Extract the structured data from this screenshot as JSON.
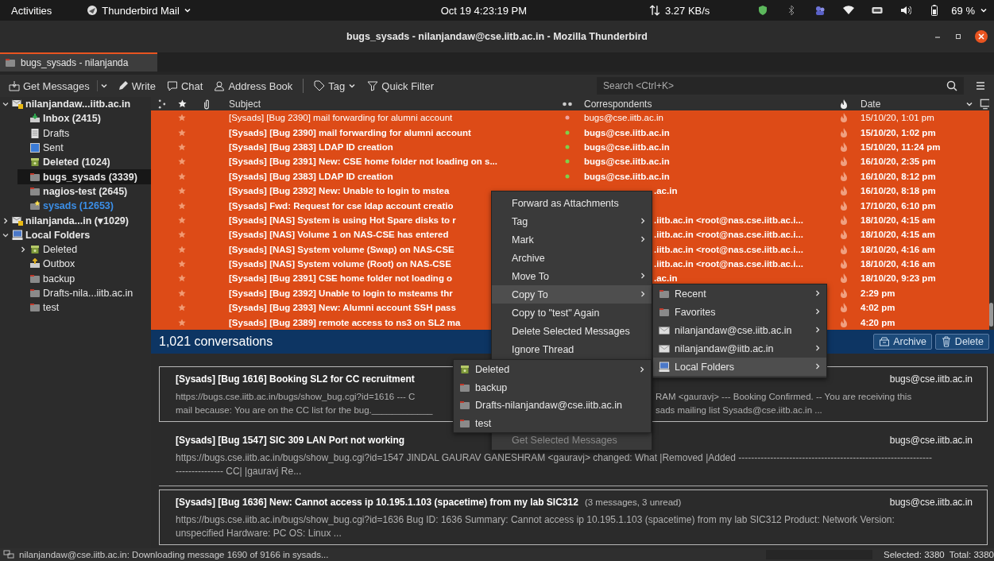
{
  "top_bar": {
    "activities": "Activities",
    "app_menu": "Thunderbird Mail",
    "clock": "Oct 19  4:23:19 PM",
    "net_speed": "3.27 KB/s",
    "battery": "69 %"
  },
  "window": {
    "title": "bugs_sysads - nilanjandaw@cse.iitb.ac.in - Mozilla Thunderbird"
  },
  "tabs": [
    {
      "label": "bugs_sysads - nilanjanda",
      "selected": true
    }
  ],
  "toolbar": [
    {
      "kind": "get",
      "label": "Get Messages"
    },
    {
      "kind": "split"
    },
    {
      "kind": "write",
      "label": "Write"
    },
    {
      "kind": "chat",
      "label": "Chat"
    },
    {
      "kind": "address",
      "label": "Address Book"
    },
    {
      "kind": "separator"
    },
    {
      "kind": "tag",
      "label": "Tag"
    },
    {
      "kind": "filter",
      "label": "Quick Filter"
    }
  ],
  "search": {
    "placeholder": "Search <Ctrl+K>"
  },
  "folders": [
    {
      "kind": "account",
      "label": "nilanjandaw...iitb.ac.in",
      "expanded": true,
      "selected": false,
      "unread": true,
      "children": [
        {
          "kind": "inbox",
          "label": "Inbox (2415)",
          "selected": false,
          "unread": true
        },
        {
          "kind": "drafts",
          "label": "Drafts",
          "selected": false,
          "unread": false
        },
        {
          "kind": "sent",
          "label": "Sent",
          "selected": false,
          "unread": false
        },
        {
          "kind": "trash",
          "label": "Deleted (1024)",
          "selected": false,
          "unread": true
        },
        {
          "kind": "folder",
          "label": "bugs_sysads (3339)",
          "selected": true,
          "unread": true
        },
        {
          "kind": "folder",
          "label": "nagios-test (2645)",
          "selected": false,
          "unread": true
        },
        {
          "kind": "newmail",
          "label": "sysads (12653)",
          "selected": false,
          "unread": true
        }
      ]
    },
    {
      "kind": "account",
      "label": "nilanjanda...in (▾1029)",
      "expanded": false,
      "selected": false,
      "unread": true
    },
    {
      "kind": "local",
      "label": "Local Folders",
      "expanded": true,
      "selected": false,
      "unread": true,
      "children": [
        {
          "kind": "trash",
          "label": "Deleted",
          "expanded": false,
          "selected": false,
          "unread": false
        },
        {
          "kind": "outbox",
          "label": "Outbox",
          "selected": false,
          "unread": false
        },
        {
          "kind": "folder",
          "label": "backup",
          "selected": false,
          "unread": false
        },
        {
          "kind": "folder",
          "label": "Drafts-nila...iitb.ac.in",
          "selected": false,
          "unread": false
        },
        {
          "kind": "folder",
          "label": "test",
          "selected": false,
          "unread": false
        }
      ]
    }
  ],
  "message_list": {
    "columns": {
      "subject": "Subject",
      "correspondents": "Correspondents",
      "date": "Date"
    },
    "rows": [
      {
        "subject": "[Sysads] [Bug 2390] mail forwarding for alumni account",
        "correspondent": "bugs@cse.iitb.ac.in",
        "date": "15/10/20, 1:01 pm",
        "unread": false,
        "selected": true
      },
      {
        "subject": "[Sysads] [Bug 2390] mail forwarding for alumni account",
        "correspondent": "bugs@cse.iitb.ac.in",
        "date": "15/10/20, 1:02 pm",
        "unread": true,
        "selected": true
      },
      {
        "subject": "[Sysads] [Bug 2383] LDAP ID creation",
        "correspondent": "bugs@cse.iitb.ac.in",
        "date": "15/10/20, 11:24 pm",
        "unread": true,
        "selected": true
      },
      {
        "subject": "[Sysads] [Bug 2391] New: CSE home folder not loading on s...",
        "correspondent": "bugs@cse.iitb.ac.in",
        "date": "16/10/20, 2:35 pm",
        "unread": true,
        "selected": true
      },
      {
        "subject": "[Sysads] [Bug 2383] LDAP ID creation",
        "correspondent": "bugs@cse.iitb.ac.in",
        "date": "16/10/20, 8:12 pm",
        "unread": true,
        "selected": true
      },
      {
        "subject": "[Sysads] [Bug 2392] New: Unable to login to mstea",
        "correspondent": ".ac.in",
        "date": "16/10/20, 8:18 pm",
        "unread": true,
        "selected": true
      },
      {
        "subject": "[Sysads] Fwd: Request for cse ldap account creatio",
        "date": "17/10/20, 6:10 pm",
        "unread": true,
        "selected": true
      },
      {
        "subject": "[Sysads] [NAS] System is using Hot Spare disks to r",
        "correspondent": ".iitb.ac.in <root@nas.cse.iitb.ac.i...",
        "date": "18/10/20, 4:15 am",
        "unread": true,
        "selected": true
      },
      {
        "subject": "[Sysads] [NAS] Volume 1 on NAS-CSE has entered",
        "correspondent": ".iitb.ac.in <root@nas.cse.iitb.ac.i...",
        "date": "18/10/20, 4:15 am",
        "unread": true,
        "selected": true
      },
      {
        "subject": "[Sysads] [NAS] System volume (Swap) on NAS-CSE",
        "correspondent": ".iitb.ac.in <root@nas.cse.iitb.ac.i...",
        "date": "18/10/20, 4:16 am",
        "unread": true,
        "selected": true
      },
      {
        "subject": "[Sysads] [NAS] System volume (Root) on NAS-CSE",
        "correspondent": ".iitb.ac.in <root@nas.cse.iitb.ac.i...",
        "date": "18/10/20, 4:16 am",
        "unread": true,
        "selected": true
      },
      {
        "subject": "[Sysads] [Bug 2391] CSE home folder not loading o",
        "correspondent": ".ac.in",
        "date": "18/10/20, 9:23 pm",
        "unread": true,
        "selected": true
      },
      {
        "subject": "[Sysads] [Bug 2392] Unable to login to msteams thr",
        "date": "2:29 pm",
        "unread": true,
        "selected": true
      },
      {
        "subject": "[Sysads] [Bug 2393] New: Alumni account SSH pass",
        "date": "4:02 pm",
        "unread": true,
        "selected": true
      },
      {
        "subject": "[Sysads] [Bug 2389] remote access to ns3 on SL2 ma",
        "date": "4:20 pm",
        "unread": true,
        "selected": true
      }
    ]
  },
  "conversations": {
    "count": "1,021 conversations",
    "buttons": [
      {
        "kind": "archive",
        "label": "Archive"
      },
      {
        "kind": "delete",
        "label": "Delete"
      }
    ]
  },
  "cards": [
    {
      "title": "[Sysads] [Bug 1616] Booking SL2 for CC recruitment",
      "sender": "bugs@cse.iitb.ac.in",
      "selected": true,
      "split_lines": [
        {
          "left": "https://bugs.cse.iitb.ac.in/bugs/show_bug.cgi?id=1616 --- C",
          "right": "RAM <gauravj> --- Booking Confirmed. -- You are receiving this"
        },
        {
          "left": "mail because: You are on the CC list for the bug.____________",
          "right": "sads mailing list Sysads@cse.iitb.ac.in ..."
        }
      ]
    },
    {
      "title": "[Sysads] [Bug 1547] SIC 309 LAN Port not working",
      "sender": "bugs@cse.iitb.ac.in",
      "selected": false,
      "body": "https://bugs.cse.iitb.ac.in/bugs/show_bug.cgi?id=1547 JINDAL GAURAV GANESHRAM <gauravj> changed: What |Removed |Added ---------------------------------------------------------------------------- CC| |gauravj Re..."
    },
    {
      "title": "[Sysads] [Bug 1636] New: Cannot access ip 10.195.1.103 (spacetime) from my lab SIC312",
      "summary": "(3 messages, 3 unread)",
      "sender": "bugs@cse.iitb.ac.in",
      "selected": true,
      "body": "https://bugs.cse.iitb.ac.in/bugs/show_bug.cgi?id=1636 Bug ID: 1636 Summary: Cannot access ip 10.195.1.103 (spacetime) from my lab SIC312 Product: Network Version: unspecified Hardware: PC OS: Linux ..."
    }
  ],
  "context_menu": [
    {
      "label": "Forward as Attachments",
      "submenu": false,
      "selected": false,
      "disabled": false
    },
    {
      "label": "Tag",
      "submenu": true,
      "selected": false,
      "disabled": false
    },
    {
      "label": "Mark",
      "submenu": true,
      "selected": false,
      "disabled": false
    },
    {
      "label": "Archive",
      "submenu": false,
      "selected": false,
      "disabled": false
    },
    {
      "label": "Move To",
      "submenu": true,
      "selected": false,
      "disabled": false
    },
    {
      "label": "Copy To",
      "submenu": true,
      "selected": true,
      "disabled": false
    },
    {
      "label": "Copy to \"test\" Again",
      "submenu": false,
      "selected": false,
      "disabled": false
    },
    {
      "label": "Delete Selected Messages",
      "submenu": false,
      "selected": false,
      "disabled": false
    },
    {
      "label": "Ignore Thread",
      "submenu": false,
      "selected": false,
      "disabled": false
    },
    {
      "label": "Get Selected Messages",
      "submenu": false,
      "selected": false,
      "disabled": true
    }
  ],
  "copy_to_menu": [
    {
      "kind": "folder",
      "label": "Recent",
      "selected": false
    },
    {
      "kind": "folder",
      "label": "Favorites",
      "selected": false
    },
    {
      "kind": "mail",
      "label": "nilanjandaw@cse.iitb.ac.in",
      "selected": false
    },
    {
      "kind": "mail",
      "label": "nilanjandaw@iitb.ac.in",
      "selected": false
    },
    {
      "kind": "local",
      "label": "Local Folders",
      "selected": true
    }
  ],
  "local_folders_menu": [
    {
      "kind": "trash",
      "label": "Deleted",
      "submenu": true
    },
    {
      "kind": "folder",
      "label": "backup",
      "submenu": false
    },
    {
      "kind": "folder",
      "label": "Drafts-nilanjandaw@cse.iitb.ac.in",
      "submenu": false
    },
    {
      "kind": "folder",
      "label": "test",
      "submenu": false
    }
  ],
  "status_bar": {
    "message": "nilanjandaw@cse.iitb.ac.in: Downloading message 1690 of 9166 in sysads...",
    "level": 0,
    "selected": "Selected: 3380",
    "total": "Total: 3380"
  }
}
